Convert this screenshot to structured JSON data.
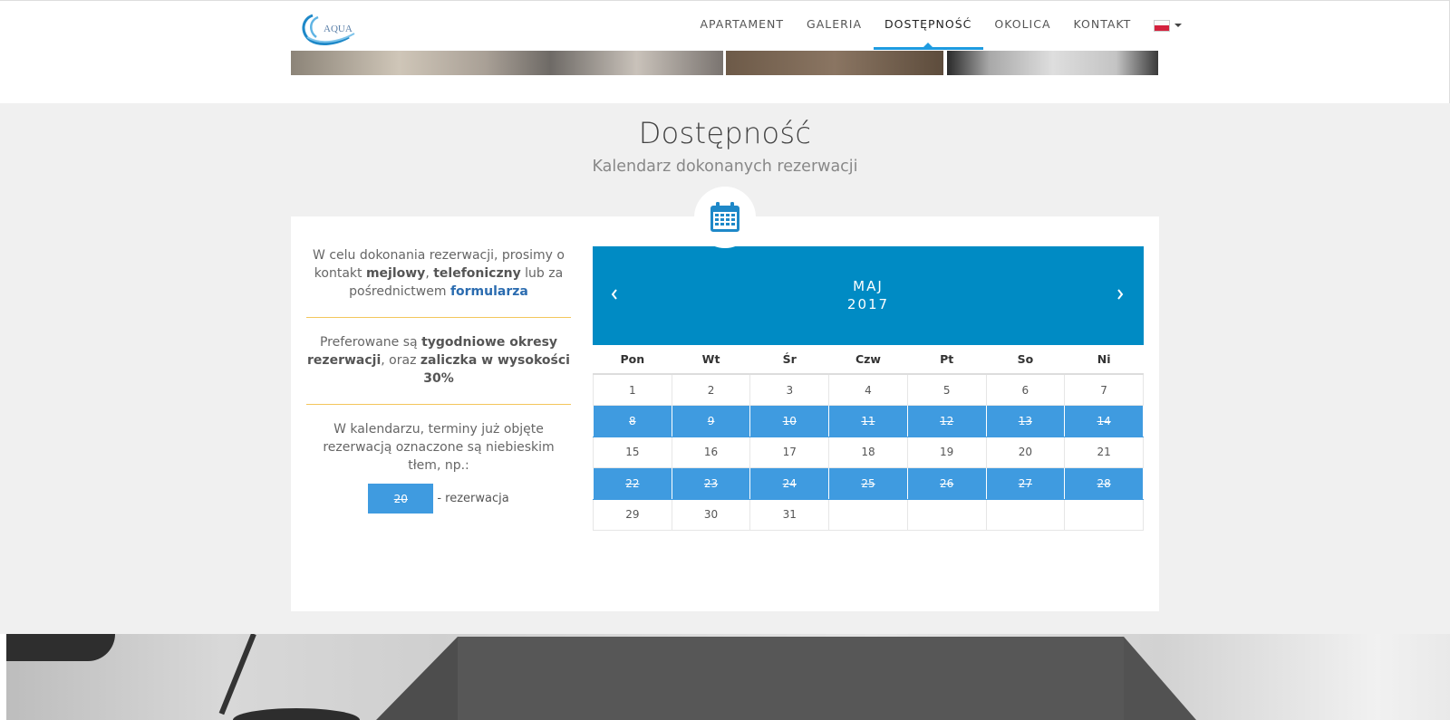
{
  "header": {
    "logo_text": "AQUA",
    "nav": [
      "APARTAMENT",
      "GALERIA",
      "DOSTĘPNOŚĆ",
      "OKOLICA",
      "KONTAKT"
    ],
    "active_nav": "DOSTĘPNOŚĆ",
    "language": "PL"
  },
  "section": {
    "title": "Dostępność",
    "subtitle": "Kalendarz dokonanych rezerwacji",
    "icon": "calendar-icon"
  },
  "info": {
    "p1_a": "W celu dokonania rezerwacji, prosimy o kontakt ",
    "p1_b": "mejlowy",
    "p1_c": ", ",
    "p1_d": "telefoniczny",
    "p1_e": " lub za pośrednictwem ",
    "p1_link": "formularza",
    "p2_a": "Preferowane są ",
    "p2_b": "tygodniowe okresy rezerwacji",
    "p2_c": ", oraz ",
    "p2_d": "zaliczka w wysokości 30%",
    "p3": "W kalendarzu, terminy już objęte rezerwacją oznaczone są niebieskim tłem, np.:",
    "legend_day": "20",
    "legend_text": "- rezerwacja"
  },
  "calendar": {
    "month": "MAJ",
    "year": "2017",
    "weekdays": [
      "Pon",
      "Wt",
      "Śr",
      "Czw",
      "Pt",
      "So",
      "Ni"
    ],
    "weeks": [
      [
        "1",
        "2",
        "3",
        "4",
        "5",
        "6",
        "7"
      ],
      [
        "8",
        "9",
        "10",
        "11",
        "12",
        "13",
        "14"
      ],
      [
        "15",
        "16",
        "17",
        "18",
        "19",
        "20",
        "21"
      ],
      [
        "22",
        "23",
        "24",
        "25",
        "26",
        "27",
        "28"
      ],
      [
        "29",
        "30",
        "31",
        "",
        "",
        "",
        ""
      ]
    ],
    "booked": [
      "8",
      "9",
      "10",
      "11",
      "12",
      "13",
      "14",
      "22",
      "23",
      "24",
      "25",
      "26",
      "27",
      "28"
    ],
    "header_color": "#008bc4",
    "booked_color": "#3f9be0"
  }
}
